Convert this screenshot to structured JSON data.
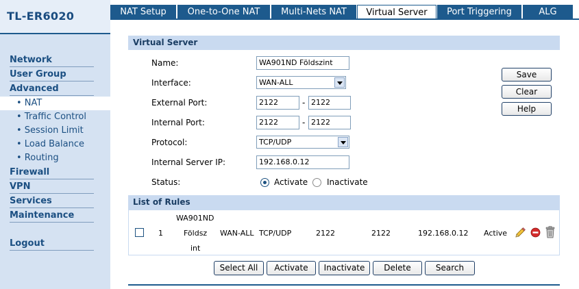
{
  "brand": "TL-ER6020",
  "sidebar": {
    "items": [
      {
        "label": "Network"
      },
      {
        "label": "User Group"
      },
      {
        "label": "Advanced"
      }
    ],
    "sub_items": [
      {
        "label": "• NAT"
      },
      {
        "label": "• Traffic Control"
      },
      {
        "label": "• Session Limit"
      },
      {
        "label": "• Load Balance"
      },
      {
        "label": "• Routing"
      }
    ],
    "lower_items": [
      {
        "label": "Firewall"
      },
      {
        "label": "VPN"
      },
      {
        "label": "Services"
      },
      {
        "label": "Maintenance"
      }
    ],
    "logout": "Logout"
  },
  "tabs": [
    {
      "label": "NAT Setup"
    },
    {
      "label": "One-to-One NAT"
    },
    {
      "label": "Multi-Nets NAT"
    },
    {
      "label": "Virtual Server",
      "active": true
    },
    {
      "label": "Port Triggering"
    },
    {
      "label": "ALG"
    }
  ],
  "form": {
    "header": "Virtual Server",
    "name_label": "Name:",
    "name_value": "WA901ND Földszint",
    "interface_label": "Interface:",
    "interface_value": "WAN-ALL",
    "external_port_label": "External Port:",
    "external_port_start": "2122",
    "external_port_end": "2122",
    "internal_port_label": "Internal Port:",
    "internal_port_start": "2122",
    "internal_port_end": "2122",
    "protocol_label": "Protocol:",
    "protocol_value": "TCP/UDP",
    "server_ip_label": "Internal Server IP:",
    "server_ip_value": "192.168.0.12",
    "status_label": "Status:",
    "status_activate": "Activate",
    "status_inactivate": "Inactivate",
    "status_selected": "Activate",
    "dash": "-"
  },
  "side_buttons": {
    "save": "Save",
    "clear": "Clear",
    "help": "Help"
  },
  "rules": {
    "header": "List of Rules",
    "rows": [
      {
        "index": "1",
        "name_line1": "WA901ND",
        "name_line2": "Földsz",
        "name_line3": "int",
        "interface": "WAN-ALL",
        "protocol": "TCP/UDP",
        "external_port": "2122",
        "internal_port": "2122",
        "server_ip": "192.168.0.12",
        "status": "Active"
      }
    ]
  },
  "bottom_buttons": {
    "select_all": "Select All",
    "activate": "Activate",
    "inactivate": "Inactivate",
    "delete": "Delete",
    "search": "Search"
  },
  "colors": {
    "accent": "#1d5a8d",
    "sidebar_bg": "#d5e2f2",
    "section_header_bg": "#c9daf0"
  }
}
